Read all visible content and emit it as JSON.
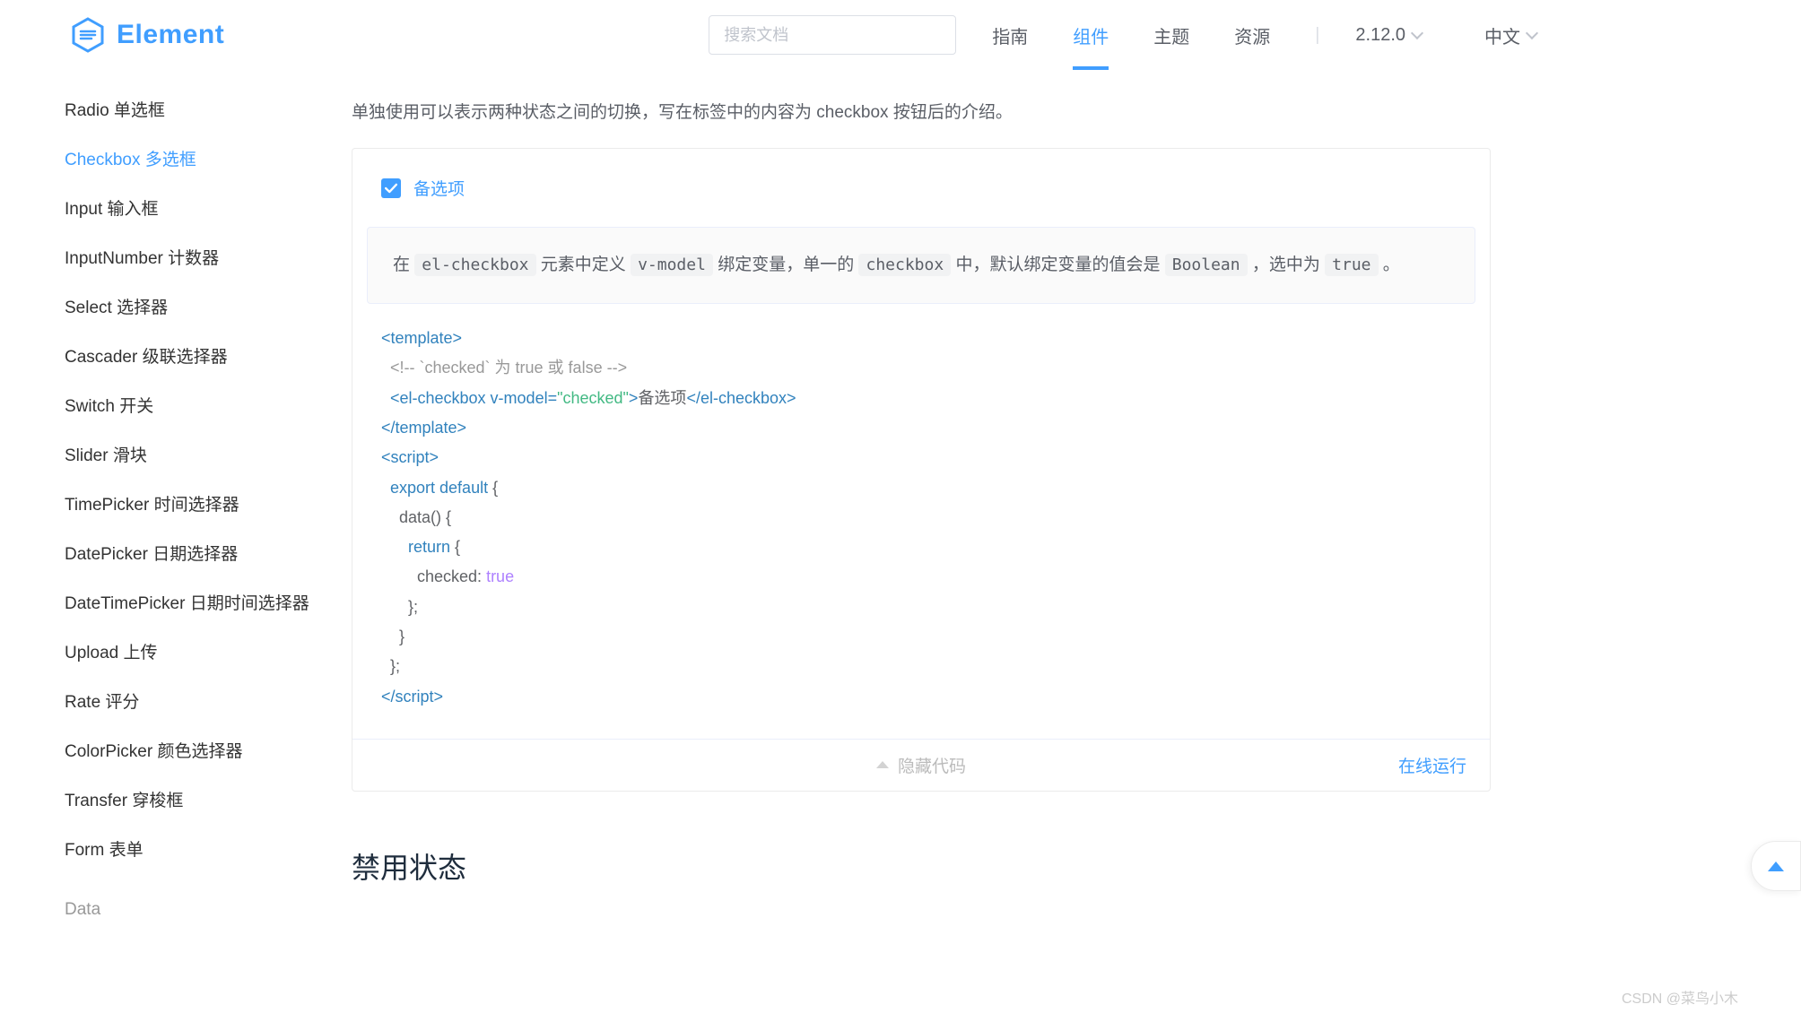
{
  "header": {
    "brand": "Element",
    "search_placeholder": "搜索文档",
    "nav": {
      "guide": "指南",
      "component": "组件",
      "theme": "主题",
      "resource": "资源"
    },
    "version": "2.12.0",
    "lang": "中文"
  },
  "sidebar": {
    "items": [
      {
        "label": "Radio 单选框"
      },
      {
        "label": "Checkbox 多选框"
      },
      {
        "label": "Input 输入框"
      },
      {
        "label": "InputNumber 计数器"
      },
      {
        "label": "Select 选择器"
      },
      {
        "label": "Cascader 级联选择器"
      },
      {
        "label": "Switch 开关"
      },
      {
        "label": "Slider 滑块"
      },
      {
        "label": "TimePicker 时间选择器"
      },
      {
        "label": "DatePicker 日期选择器"
      },
      {
        "label": "DateTimePicker 日期时间选择器"
      },
      {
        "label": "Upload 上传"
      },
      {
        "label": "Rate 评分"
      },
      {
        "label": "ColorPicker 颜色选择器"
      },
      {
        "label": "Transfer 穿梭框"
      },
      {
        "label": "Form 表单"
      }
    ],
    "cat_data": "Data",
    "active_index": 1
  },
  "main": {
    "intro": "单独使用可以表示两种状态之间的切换，写在标签中的内容为 checkbox 按钮后的介绍。",
    "demo": {
      "checkbox_label": "备选项",
      "tip": {
        "t0": "在 ",
        "c1": "el-checkbox",
        "t1": " 元素中定义 ",
        "c2": "v-model",
        "t2": " 绑定变量，单一的 ",
        "c3": "checkbox",
        "t3": " 中，默认绑定变量的值会是 ",
        "c4": "Boolean",
        "t4": " ，选中为 ",
        "c5": "true",
        "t5": " 。"
      },
      "code": {
        "l1_open": "<template>",
        "l2_comment": "  <!-- `checked` 为 true 或 false -->",
        "l3_open": "  <el-checkbox v-model=",
        "l3_str": "\"checked\"",
        "l3_mid": ">",
        "l3_text": "备选项",
        "l3_close": "</el-checkbox>",
        "l4_close": "</template>",
        "l5_open": "<script>",
        "l6": "  export default",
        "l6_brace": " {",
        "l7": "    data() {",
        "l8": "      return",
        "l8_brace": " {",
        "l9_key": "        checked: ",
        "l9_val": "true",
        "l10": "      };",
        "l11": "    }",
        "l12": "  };",
        "l13_close": "</scr"
      },
      "hide_code": "隐藏代码",
      "run_online": "在线运行"
    },
    "next_section": "禁用状态"
  },
  "footer_watermark": "CSDN @菜鸟小木"
}
